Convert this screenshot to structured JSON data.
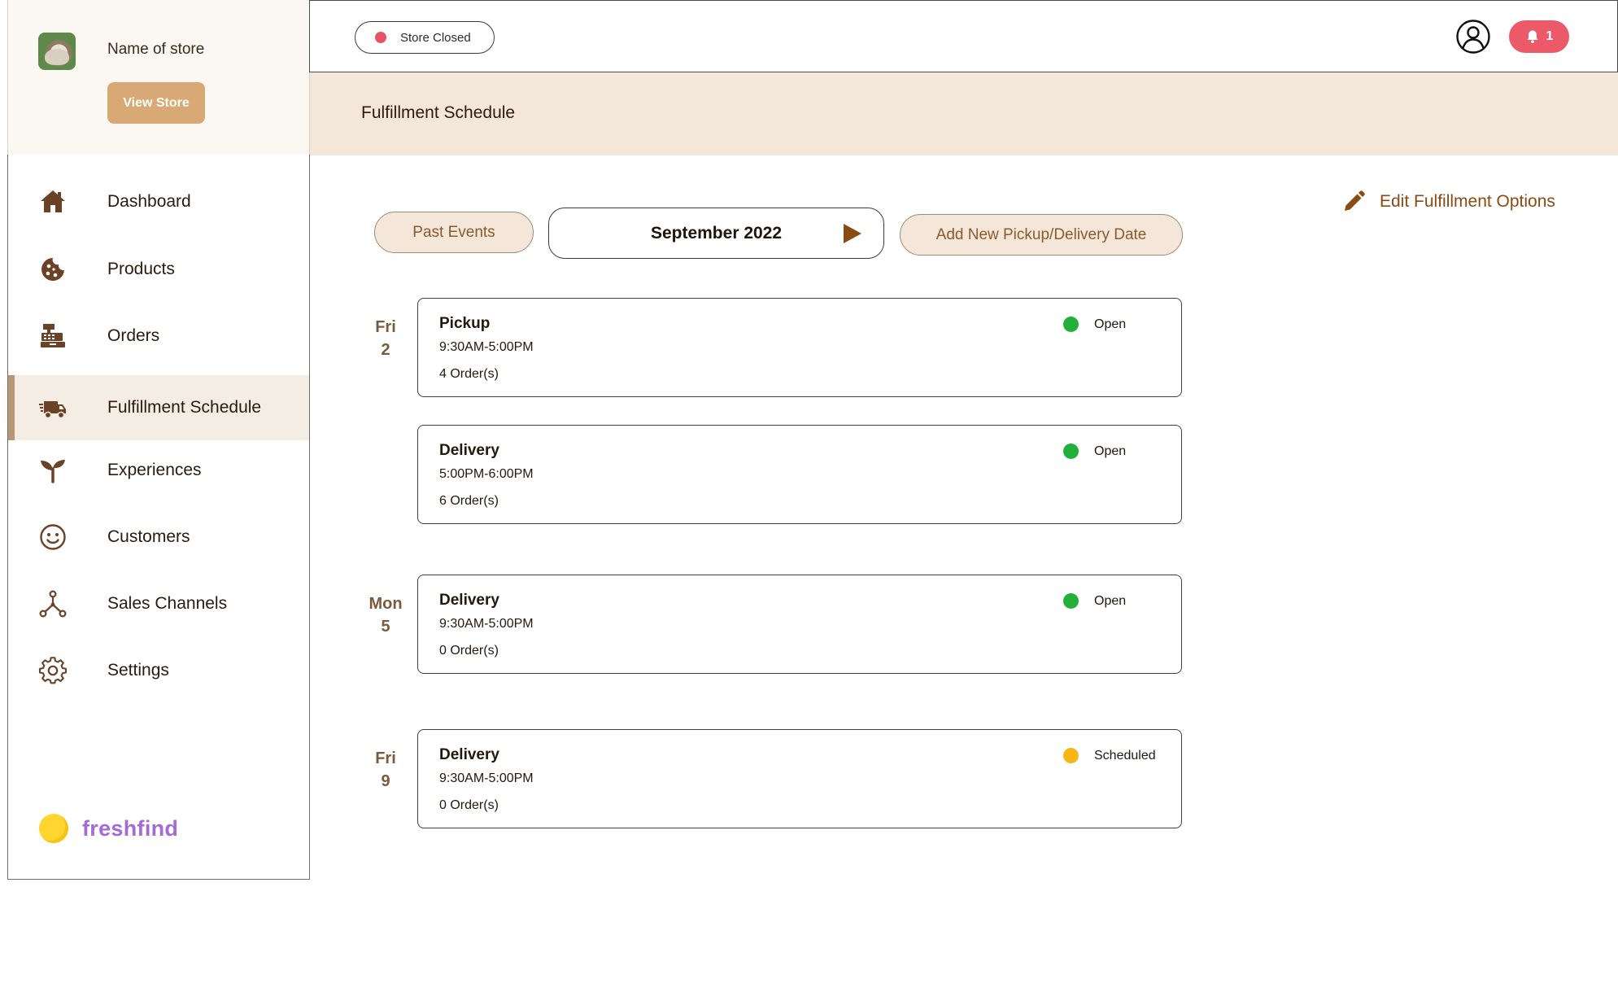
{
  "store": {
    "name": "Name of store",
    "view_store_label": "View Store"
  },
  "sidebar": {
    "items": [
      {
        "label": "Dashboard",
        "icon": "home-icon"
      },
      {
        "label": "Products",
        "icon": "cookie-icon"
      },
      {
        "label": "Orders",
        "icon": "cash-register-icon"
      },
      {
        "label": "Fulfillment Schedule",
        "icon": "delivery-truck-icon",
        "active": true
      },
      {
        "label": "Experiences",
        "icon": "sprout-icon"
      },
      {
        "label": "Customers",
        "icon": "smiley-icon"
      },
      {
        "label": "Sales Channels",
        "icon": "network-icon"
      },
      {
        "label": "Settings",
        "icon": "gear-icon"
      }
    ],
    "brand": "freshfind"
  },
  "topbar": {
    "store_status": "Store Closed",
    "notification_count": "1"
  },
  "page": {
    "title": "Fulfillment Schedule"
  },
  "controls": {
    "past_events": "Past Events",
    "month": "September 2022",
    "add_date": "Add New Pickup/Delivery Date",
    "edit_options": "Edit Fulfillment Options"
  },
  "schedule": [
    {
      "day_name": "Fri",
      "day_num": "2"
    },
    {
      "day_name": "Mon",
      "day_num": "5"
    },
    {
      "day_name": "Fri",
      "day_num": "9"
    }
  ],
  "events": [
    {
      "type": "Pickup",
      "time": "9:30AM-5:00PM",
      "orders": "4 Order(s)",
      "status": "Open"
    },
    {
      "type": "Delivery",
      "time": "5:00PM-6:00PM",
      "orders": "6 Order(s)",
      "status": "Open"
    },
    {
      "type": "Delivery",
      "time": "9:30AM-5:00PM",
      "orders": "0 Order(s)",
      "status": "Open"
    },
    {
      "type": "Delivery",
      "time": "9:30AM-5:00PM",
      "orders": "0 Order(s)",
      "status": "Scheduled"
    }
  ],
  "colors": {
    "accent_brown": "#7a4a20",
    "status_open": "#22b03a",
    "status_scheduled": "#f6b614",
    "store_closed": "#e95264",
    "header_bg": "#f3e7da",
    "brand_purple": "#a46ad8"
  }
}
